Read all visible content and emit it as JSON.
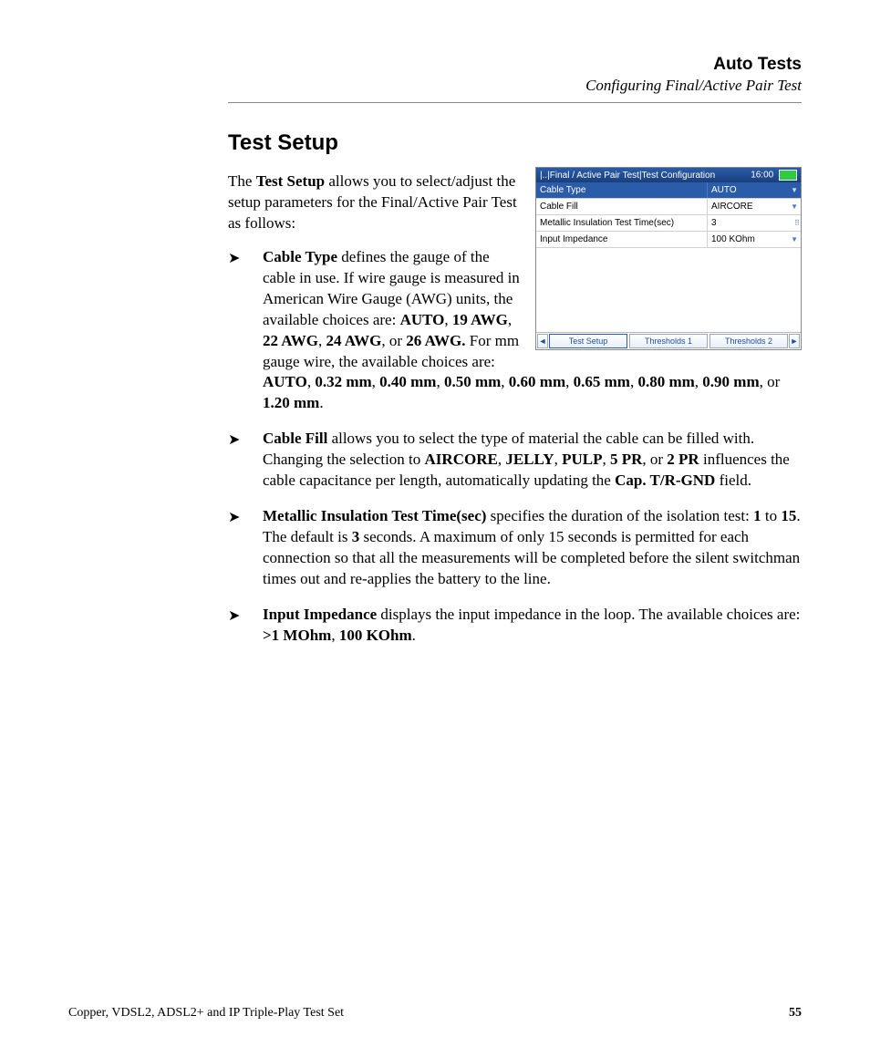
{
  "header": {
    "title": "Auto Tests",
    "subtitle": "Configuring Final/Active Pair Test"
  },
  "section_title": "Test Setup",
  "intro": {
    "pre": "The ",
    "bold": "Test Setup",
    "post": " allows you to select/adjust the setup parameters for the Final/Active Pair Test as follows:"
  },
  "screenshot": {
    "breadcrumb": "|..|Final / Active Pair Test|Test Configuration",
    "time": "16:00",
    "rows": [
      {
        "label": "Cable Type",
        "value": "AUTO",
        "selected": true
      },
      {
        "label": "Cable Fill",
        "value": "AIRCORE",
        "selected": false
      },
      {
        "label": "Metallic Insulation Test Time(sec)",
        "value": "3",
        "selected": false
      },
      {
        "label": "Input Impedance",
        "value": "100 KOhm",
        "selected": false
      }
    ],
    "tabs": [
      "Test Setup",
      "Thresholds 1",
      "Thresholds 2"
    ],
    "active_tab": 0
  },
  "bullets": {
    "b1": {
      "t1": "Cable Type",
      "t2": " defines the gauge of the cable in use. If wire gauge is measured in American Wire Gauge (AWG) units, the available choices are: ",
      "t3": "AUTO",
      "t4": ", ",
      "t5": "19 AWG",
      "t6": ", ",
      "t7": "22 AWG",
      "t8": ", ",
      "t9": "24 AWG",
      "t10": ", or ",
      "t11": "26 AWG.",
      "t12": " For mm gauge wire, the available choices are: ",
      "t13": "AUTO",
      "t14": ", ",
      "t15": "0.32 mm",
      "t16": ", ",
      "t17": "0.40 mm",
      "t18": ", ",
      "t19": "0.50 mm",
      "t20": ", ",
      "t21": "0.60 mm",
      "t22": ", ",
      "t23": "0.65 mm",
      "t24": ", ",
      "t25": "0.80 mm",
      "t26": ", ",
      "t27": "0.90 mm",
      "t28": ", or ",
      "t29": "1.20 mm",
      "t30": "."
    },
    "b2": {
      "t1": "Cable Fill",
      "t2": " allows you to select the type of material the cable can be filled with. Changing the selection to ",
      "t3": "AIRCORE",
      "t4": ", ",
      "t5": "JELLY",
      "t6": ", ",
      "t7": "PULP",
      "t8": ", ",
      "t9": "5 PR",
      "t10": ", or ",
      "t11": "2 PR",
      "t12": " influences the cable capacitance per length, automatically updating the ",
      "t13": "Cap. T/R-GND",
      "t14": " field."
    },
    "b3": {
      "t1": "Metallic Insulation Test Time(sec)",
      "t2": " specifies the duration of the isolation test: ",
      "t3": "1",
      "t4": " to ",
      "t5": "15",
      "t6": ". The default is ",
      "t7": "3",
      "t8": " seconds. A maximum of only 15 seconds is permitted for each connection so that all the measurements will be completed before the silent switchman times out and re-applies the battery to the line."
    },
    "b4": {
      "t1": "Input Impedance",
      "t2": " displays the input impedance in the loop. The available choices are: ",
      "t3": ">1 MOhm",
      "t4": ", ",
      "t5": "100 KOhm",
      "t6": "."
    }
  },
  "footer": {
    "left": "Copper, VDSL2, ADSL2+ and IP Triple-Play Test Set",
    "page": "55"
  }
}
